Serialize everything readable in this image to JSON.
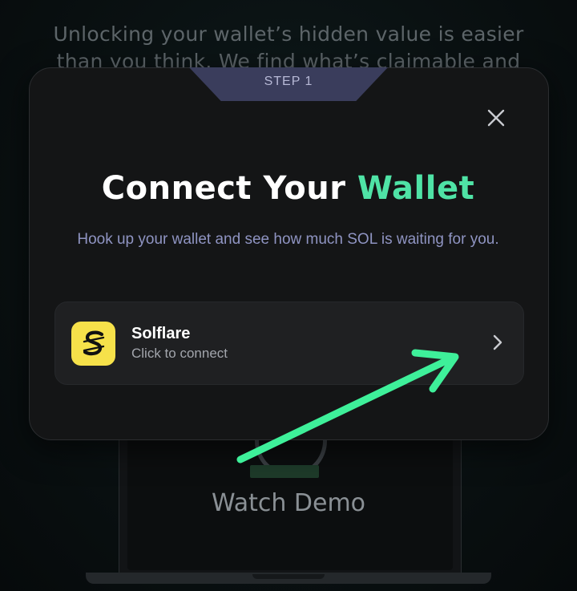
{
  "background": {
    "headline_line1": "Unlocking your wallet’s hidden value is easier",
    "headline_line2": "than you think. We find what’s claimable and",
    "watch_demo": "Watch Demo"
  },
  "modal": {
    "step_label": "STEP 1",
    "title_main": "Connect Your ",
    "title_accent": "Wallet",
    "subtitle": "Hook up your wallet and see how much SOL is waiting for you.",
    "close_icon": "close-icon",
    "wallet": {
      "name": "Solflare",
      "status": "Click to connect",
      "icon": "solflare-logo-icon"
    }
  },
  "colors": {
    "accent": "#4fe3a6",
    "arrow": "#3ef09a",
    "logo_bg": "#f6e14a",
    "step_tab": "#3a3d5c"
  }
}
